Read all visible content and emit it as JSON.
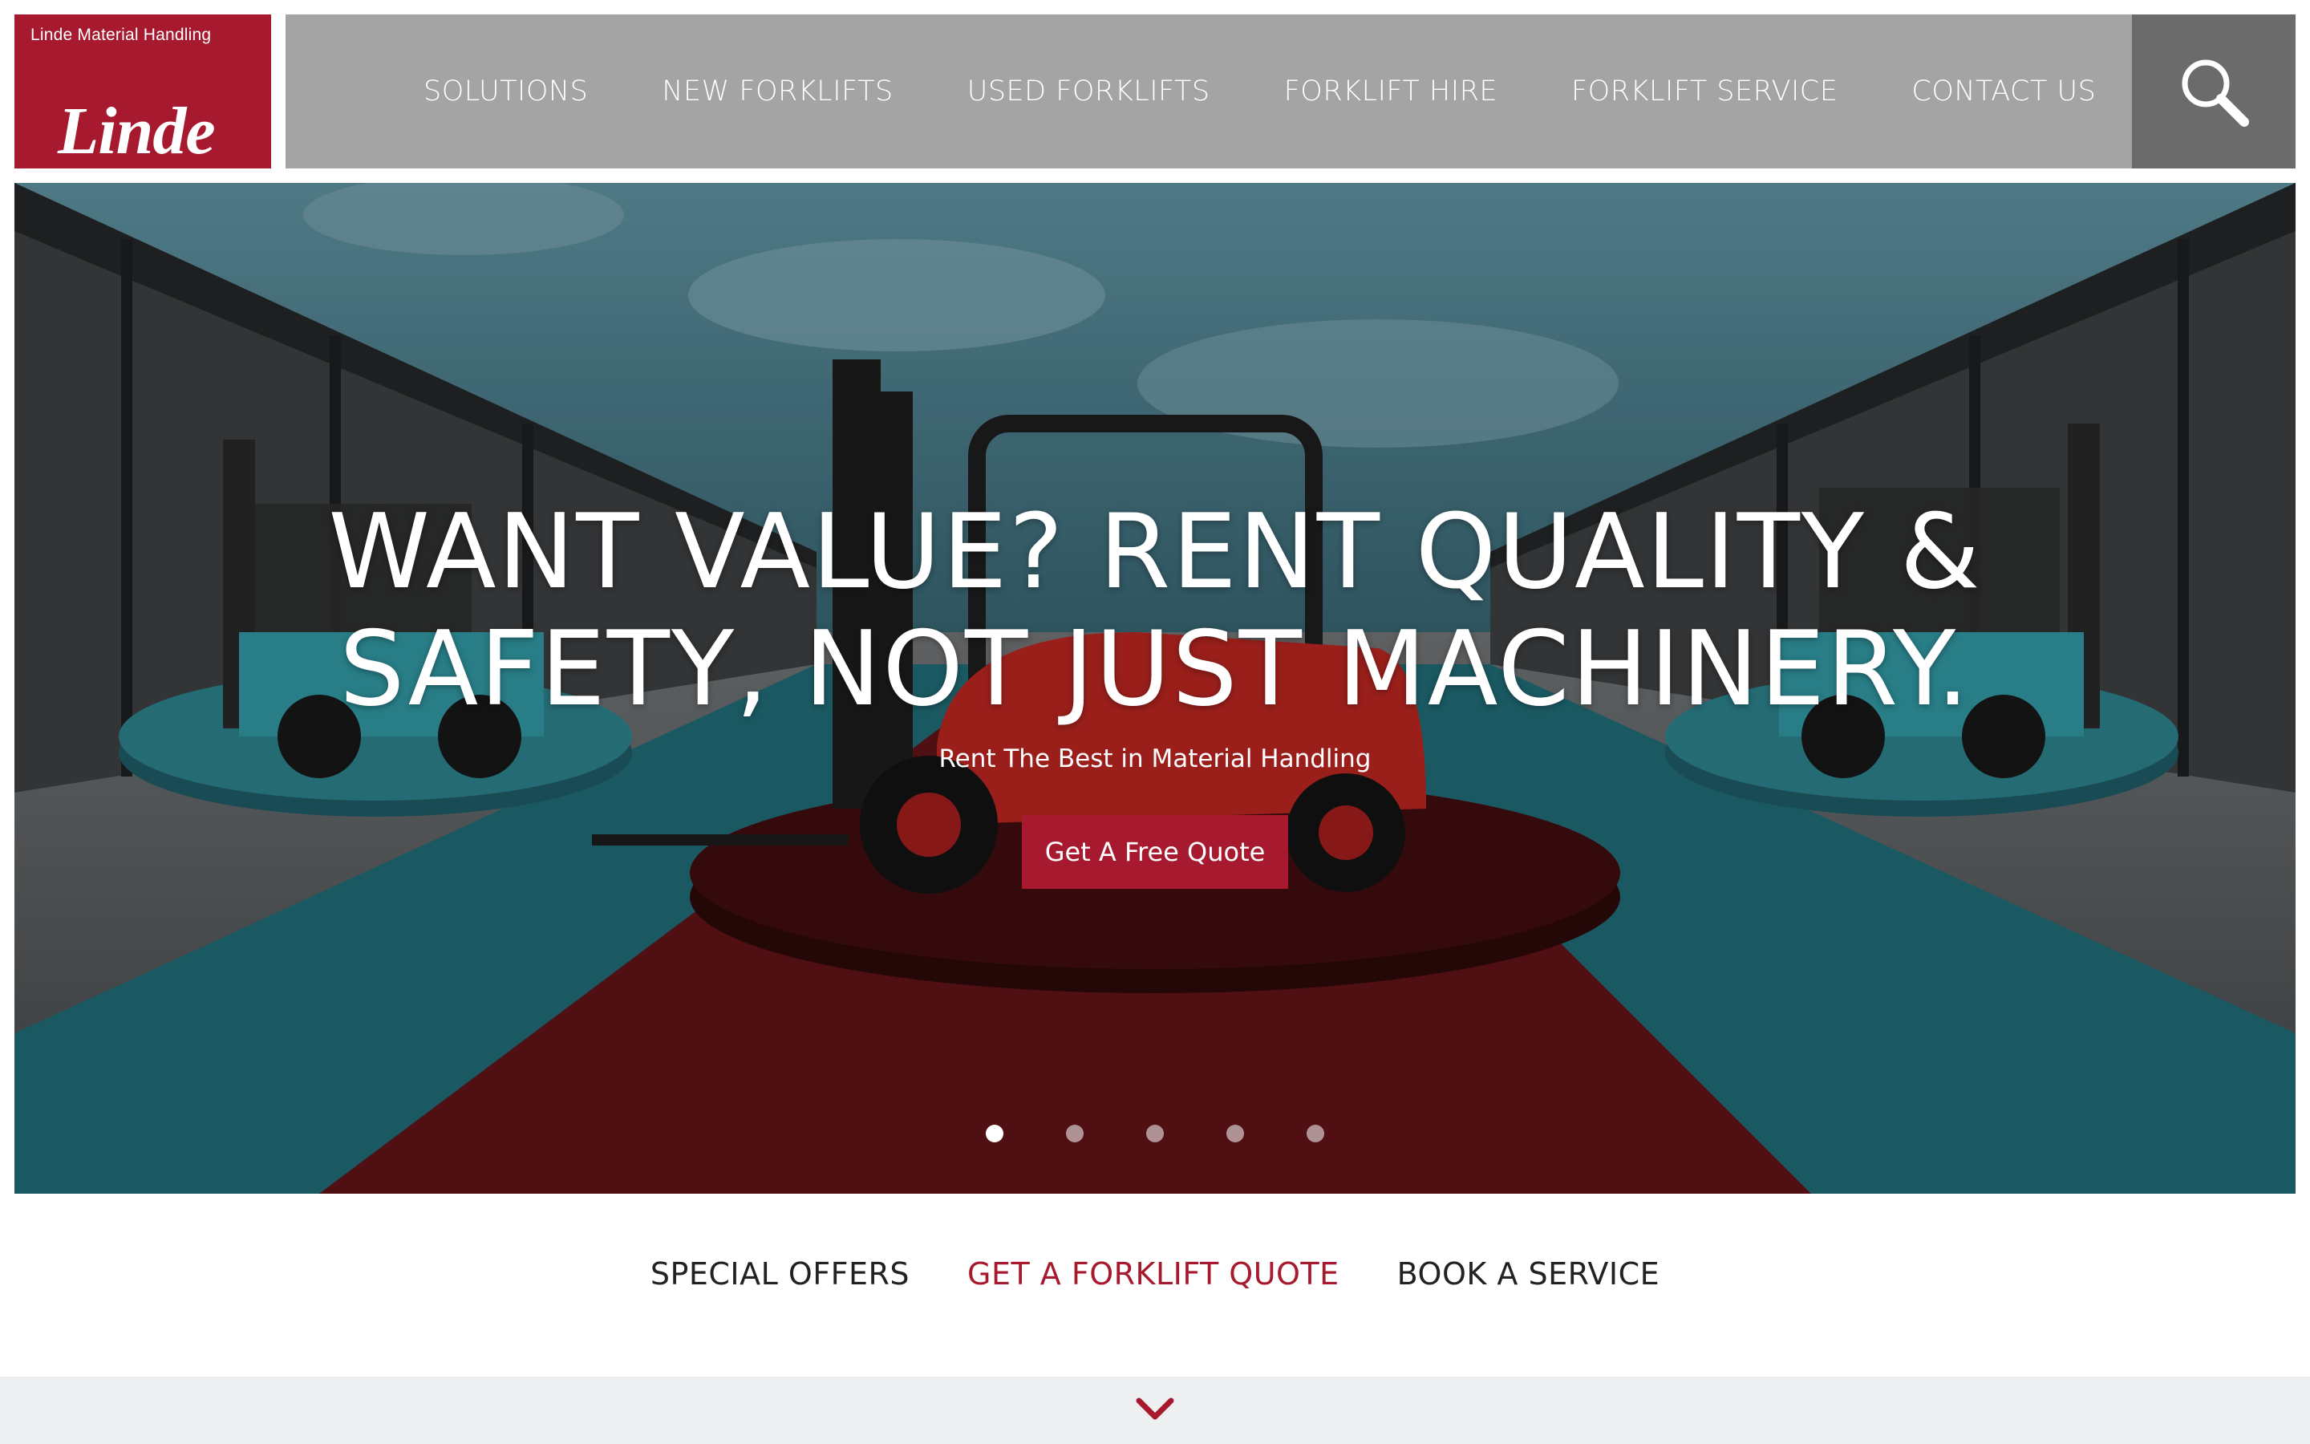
{
  "brand": {
    "sub_label": "Linde Material Handling",
    "logo_text": "Linde",
    "color": "#a6192e"
  },
  "nav": {
    "items": [
      {
        "label": "SOLUTIONS"
      },
      {
        "label": "NEW FORKLIFTS"
      },
      {
        "label": "USED FORKLIFTS"
      },
      {
        "label": "FORKLIFT HIRE"
      },
      {
        "label": "FORKLIFT SERVICE"
      },
      {
        "label": "CONTACT US"
      }
    ],
    "search_icon": "search-icon"
  },
  "hero": {
    "title_line1": "WANT VALUE? RENT QUALITY &",
    "title_line2": "SAFETY, NOT JUST MACHINERY.",
    "subtitle": "Rent The Best in Material Handling",
    "cta_label": "Get A Free Quote",
    "slide_count": 5,
    "active_slide": 1
  },
  "quick_links": [
    {
      "label": "SPECIAL OFFERS",
      "accent": false
    },
    {
      "label": "GET A FORKLIFT QUOTE",
      "accent": true
    },
    {
      "label": "BOOK A SERVICE",
      "accent": false
    }
  ],
  "footer": {
    "scroll_icon": "chevron-down-icon"
  },
  "colors": {
    "accent_red": "#a6192e",
    "nav_gray": "#a4a4a4",
    "search_gray": "#6b6b6b",
    "teal": "#1f6670"
  }
}
